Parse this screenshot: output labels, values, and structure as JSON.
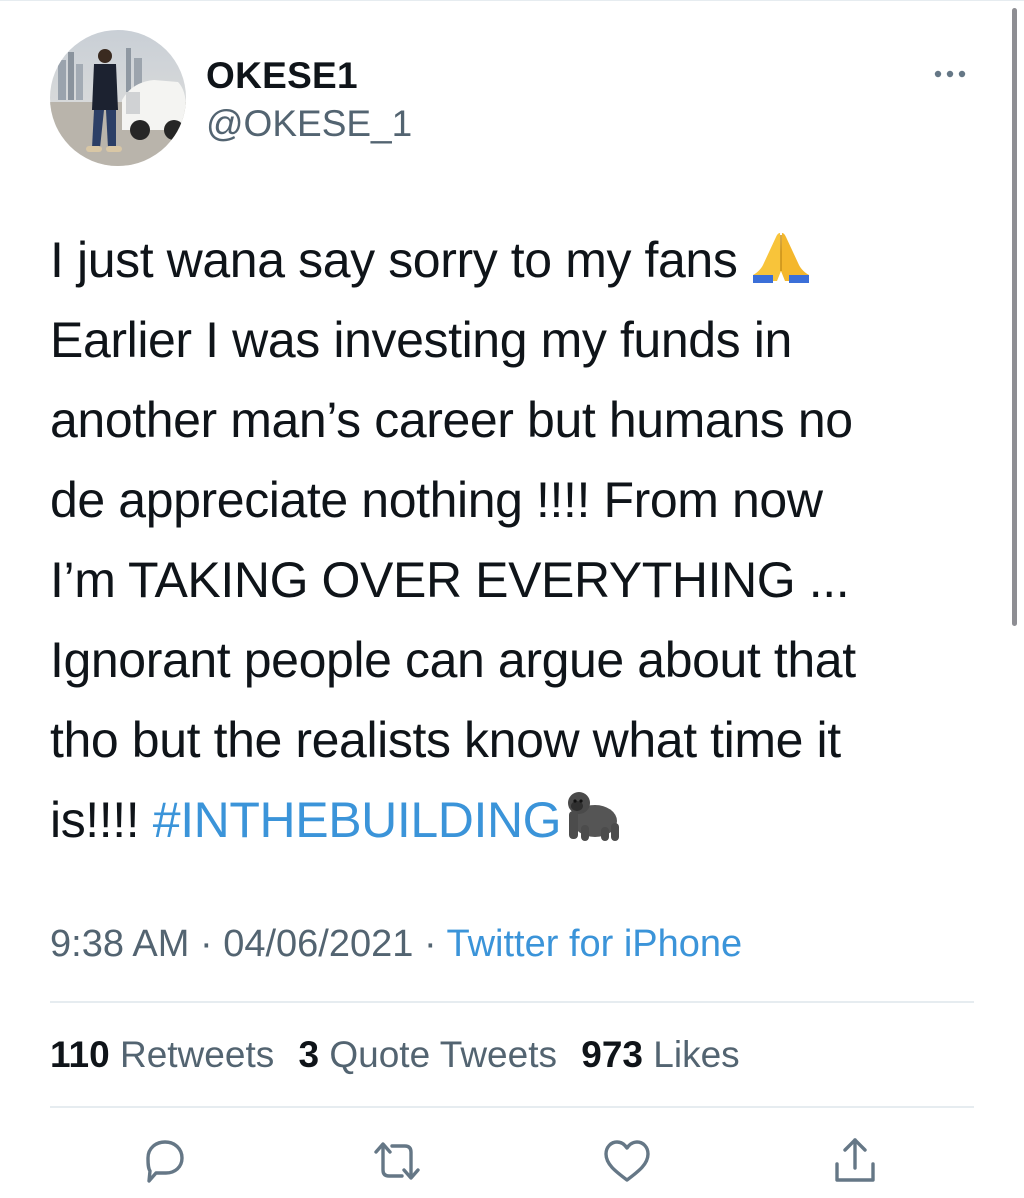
{
  "author": {
    "display_name": "OKESE1",
    "handle": "@OKESE_1"
  },
  "tweet": {
    "lines": [
      "I just wana say sorry to my fans",
      "Earlier I was investing my funds in",
      "another man’s career but humans no",
      "de appreciate nothing !!!! From now",
      "I’m TAKING OVER EVERYTHING ...",
      "Ignorant people can argue about that",
      "tho but the realists know what time it",
      "is!!!! "
    ],
    "hashtag": "#INTHEBUILDING",
    "emojis": [
      "folded-hands-emoji",
      "gorilla-emoji"
    ]
  },
  "meta": {
    "time": "9:38 AM",
    "sep1": " · ",
    "date": "04/06/2021",
    "sep2": " · ",
    "source": "Twitter for iPhone"
  },
  "stats": {
    "retweets_count": "110",
    "retweets_label": "Retweets",
    "quotes_count": "3",
    "quotes_label": "Quote Tweets",
    "likes_count": "973",
    "likes_label": "Likes"
  },
  "actions": [
    "reply-icon",
    "retweet-icon",
    "like-icon",
    "share-icon"
  ],
  "colors": {
    "text": "#0f1419",
    "secondary": "#536471",
    "link": "#3b94d9",
    "divider": "#e6ecf0",
    "icon": "#657786"
  }
}
